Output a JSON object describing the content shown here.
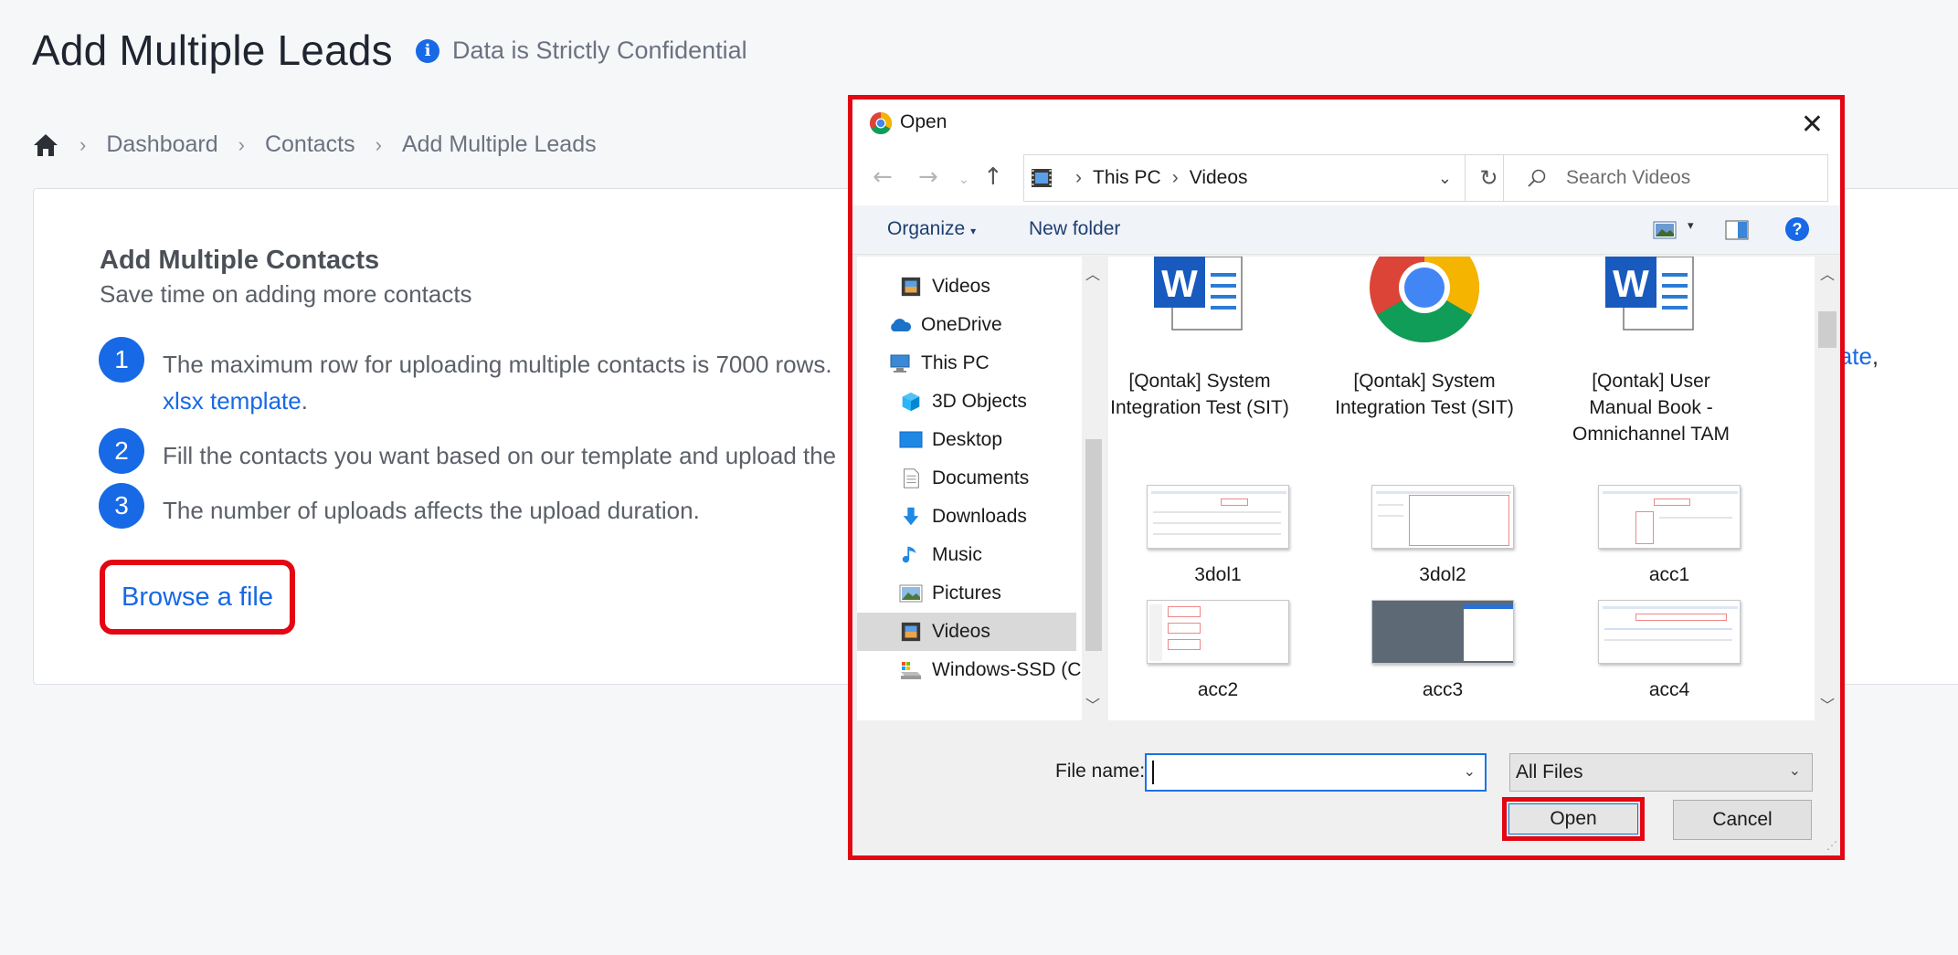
{
  "page": {
    "title": "Add Multiple Leads",
    "confidential_note": "Data is Strictly Confidential",
    "breadcrumb": [
      "Dashboard",
      "Contacts",
      "Add Multiple Leads"
    ]
  },
  "card": {
    "title": "Add Multiple Contacts",
    "subtitle": "Save time on adding more contacts",
    "steps": [
      {
        "num": "1",
        "text": "The maximum row for uploading multiple contacts is 7000 rows.",
        "link": "xlsx template",
        "after_link": "."
      },
      {
        "num": "2",
        "text": "Fill the contacts you want based on our template and upload the"
      },
      {
        "num": "3",
        "text": "The number of uploads affects the upload duration."
      }
    ],
    "right_link": "late",
    "right_link_suffix": ",",
    "browse_label": "Browse a file"
  },
  "dialog": {
    "title": "Open",
    "address": [
      "This PC",
      "Videos"
    ],
    "search_placeholder": "Search Videos",
    "toolbar": {
      "organize": "Organize",
      "new_folder": "New folder"
    },
    "nav_items": [
      {
        "label": "Videos",
        "icon": "videos-folder-icon"
      },
      {
        "label": "OneDrive",
        "icon": "onedrive-icon"
      },
      {
        "label": "This PC",
        "icon": "this-pc-icon"
      },
      {
        "label": "3D Objects",
        "icon": "3d-objects-icon"
      },
      {
        "label": "Desktop",
        "icon": "desktop-icon"
      },
      {
        "label": "Documents",
        "icon": "documents-icon"
      },
      {
        "label": "Downloads",
        "icon": "downloads-icon"
      },
      {
        "label": "Music",
        "icon": "music-icon"
      },
      {
        "label": "Pictures",
        "icon": "pictures-icon"
      },
      {
        "label": "Videos",
        "icon": "videos-folder-icon",
        "selected": true
      },
      {
        "label": "Windows-SSD (C:)",
        "icon": "drive-icon"
      }
    ],
    "files": [
      {
        "name": "[Qontak] System Integration Test (SIT)",
        "icon": "word-doc-icon"
      },
      {
        "name": "[Qontak] System Integration Test (SIT)",
        "icon": "chrome-icon"
      },
      {
        "name": "[Qontak] User Manual Book - Omnichannel TAM",
        "icon": "word-doc-icon"
      },
      {
        "name": "3dol1",
        "icon": "screenshot-thumbnail"
      },
      {
        "name": "3dol2",
        "icon": "screenshot-thumbnail"
      },
      {
        "name": "acc1",
        "icon": "screenshot-thumbnail"
      },
      {
        "name": "acc2",
        "icon": "screenshot-thumbnail"
      },
      {
        "name": "acc3",
        "icon": "screenshot-thumbnail"
      },
      {
        "name": "acc4",
        "icon": "screenshot-thumbnail"
      }
    ],
    "file_name_label": "File name:",
    "file_name_value": "",
    "file_type": "All Files",
    "open_label": "Open",
    "cancel_label": "Cancel"
  },
  "colors": {
    "accent": "#1769e6",
    "highlight": "#e30613"
  }
}
